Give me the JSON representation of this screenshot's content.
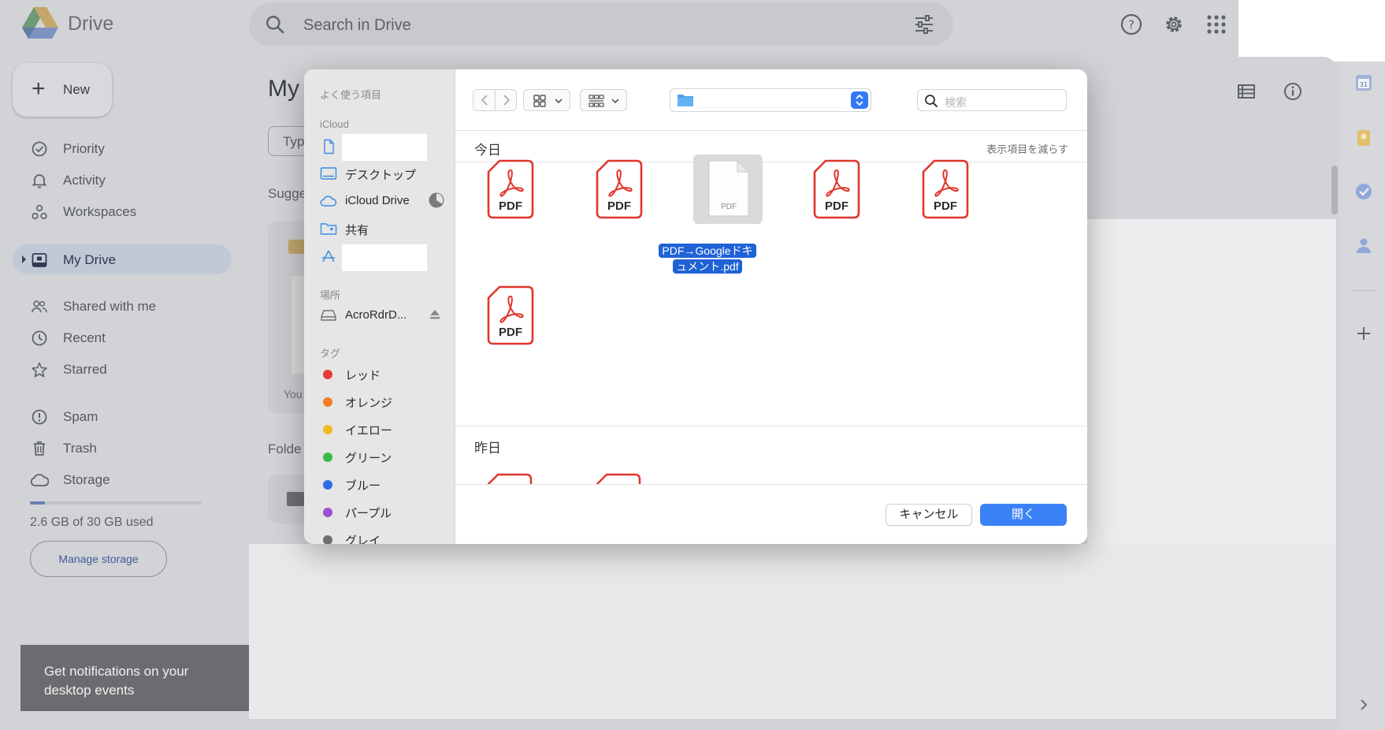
{
  "drive": {
    "app_name": "Drive",
    "search_placeholder": "Search in Drive",
    "new_label": "New",
    "nav": [
      {
        "label": "Priority",
        "icon": "priority-icon"
      },
      {
        "label": "Activity",
        "icon": "bell-icon"
      },
      {
        "label": "Workspaces",
        "icon": "workspaces-icon"
      },
      {
        "label": "My Drive",
        "icon": "my-drive-icon",
        "active": true
      },
      {
        "label": "Shared with me",
        "icon": "people-icon"
      },
      {
        "label": "Recent",
        "icon": "clock-icon"
      },
      {
        "label": "Starred",
        "icon": "star-icon"
      },
      {
        "label": "Spam",
        "icon": "spam-icon"
      },
      {
        "label": "Trash",
        "icon": "trash-icon"
      },
      {
        "label": "Storage",
        "icon": "cloud-icon"
      }
    ],
    "storage": {
      "used_text": "2.6 GB of 30 GB used",
      "used_fraction": 0.087,
      "manage_label": "Manage storage"
    },
    "toast": "Get notifications on your desktop events",
    "main": {
      "title_fragment": "My",
      "chip_fragment": "Typ",
      "suggested_fragment": "Sugge",
      "card_owner_fragment": "You",
      "folders_fragment": "Folde"
    },
    "colors": {
      "accent": "#3b82f6",
      "selected_label": "#1f62d6",
      "pdf_red": "#e0362c"
    }
  },
  "dialog": {
    "sidebar": {
      "favorites_head": "よく使う項目",
      "icloud_head": "iCloud",
      "icloud_items": [
        {
          "label": "",
          "icon": "document-icon"
        },
        {
          "label": "デスクトップ",
          "icon": "desktop-icon"
        },
        {
          "label": "iCloud Drive",
          "icon": "icloud-icon"
        },
        {
          "label": "共有",
          "icon": "shared-folder-icon"
        },
        {
          "label": "",
          "icon": "applications-icon"
        }
      ],
      "locations_head": "場所",
      "locations": [
        {
          "label": "AcroRdrD...",
          "icon": "disk-icon"
        }
      ],
      "tags_head": "タグ",
      "tags": [
        {
          "label": "レッド",
          "color": "#e53935"
        },
        {
          "label": "オレンジ",
          "color": "#f57c24"
        },
        {
          "label": "イエロー",
          "color": "#f2b824"
        },
        {
          "label": "グリーン",
          "color": "#3bb84a"
        },
        {
          "label": "ブルー",
          "color": "#2f6be2"
        },
        {
          "label": "パープル",
          "color": "#9b4fd1"
        },
        {
          "label": "グレイ",
          "color": "#6e6e6e"
        }
      ]
    },
    "search_placeholder": "検索",
    "sections": [
      {
        "title": "今日",
        "action": "表示項目を減らす"
      },
      {
        "title": "昨日"
      }
    ],
    "pdf_label": "PDF",
    "selected_file": "PDF→Googleドキュメント.pdf",
    "selected_file_lines": [
      "PDF→Googleドキ",
      "ュメント.pdf"
    ],
    "cancel_label": "キャンセル",
    "open_label": "開く"
  }
}
